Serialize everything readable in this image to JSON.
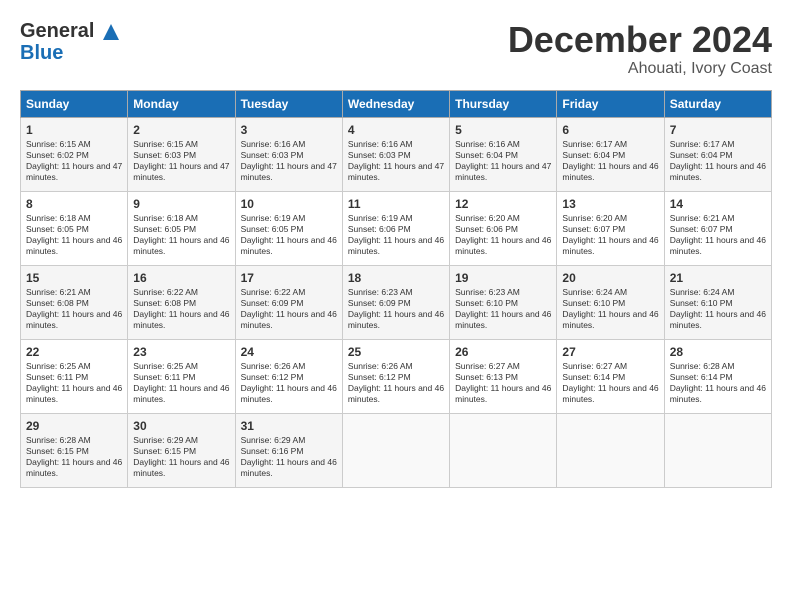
{
  "header": {
    "logo_line1": "General",
    "logo_line2": "Blue",
    "month": "December 2024",
    "location": "Ahouati, Ivory Coast"
  },
  "days_of_week": [
    "Sunday",
    "Monday",
    "Tuesday",
    "Wednesday",
    "Thursday",
    "Friday",
    "Saturday"
  ],
  "weeks": [
    [
      {
        "day": "1",
        "sunrise": "6:15 AM",
        "sunset": "6:02 PM",
        "daylight": "11 hours and 47 minutes."
      },
      {
        "day": "2",
        "sunrise": "6:15 AM",
        "sunset": "6:03 PM",
        "daylight": "11 hours and 47 minutes."
      },
      {
        "day": "3",
        "sunrise": "6:16 AM",
        "sunset": "6:03 PM",
        "daylight": "11 hours and 47 minutes."
      },
      {
        "day": "4",
        "sunrise": "6:16 AM",
        "sunset": "6:03 PM",
        "daylight": "11 hours and 47 minutes."
      },
      {
        "day": "5",
        "sunrise": "6:16 AM",
        "sunset": "6:04 PM",
        "daylight": "11 hours and 47 minutes."
      },
      {
        "day": "6",
        "sunrise": "6:17 AM",
        "sunset": "6:04 PM",
        "daylight": "11 hours and 46 minutes."
      },
      {
        "day": "7",
        "sunrise": "6:17 AM",
        "sunset": "6:04 PM",
        "daylight": "11 hours and 46 minutes."
      }
    ],
    [
      {
        "day": "8",
        "sunrise": "6:18 AM",
        "sunset": "6:05 PM",
        "daylight": "11 hours and 46 minutes."
      },
      {
        "day": "9",
        "sunrise": "6:18 AM",
        "sunset": "6:05 PM",
        "daylight": "11 hours and 46 minutes."
      },
      {
        "day": "10",
        "sunrise": "6:19 AM",
        "sunset": "6:05 PM",
        "daylight": "11 hours and 46 minutes."
      },
      {
        "day": "11",
        "sunrise": "6:19 AM",
        "sunset": "6:06 PM",
        "daylight": "11 hours and 46 minutes."
      },
      {
        "day": "12",
        "sunrise": "6:20 AM",
        "sunset": "6:06 PM",
        "daylight": "11 hours and 46 minutes."
      },
      {
        "day": "13",
        "sunrise": "6:20 AM",
        "sunset": "6:07 PM",
        "daylight": "11 hours and 46 minutes."
      },
      {
        "day": "14",
        "sunrise": "6:21 AM",
        "sunset": "6:07 PM",
        "daylight": "11 hours and 46 minutes."
      }
    ],
    [
      {
        "day": "15",
        "sunrise": "6:21 AM",
        "sunset": "6:08 PM",
        "daylight": "11 hours and 46 minutes."
      },
      {
        "day": "16",
        "sunrise": "6:22 AM",
        "sunset": "6:08 PM",
        "daylight": "11 hours and 46 minutes."
      },
      {
        "day": "17",
        "sunrise": "6:22 AM",
        "sunset": "6:09 PM",
        "daylight": "11 hours and 46 minutes."
      },
      {
        "day": "18",
        "sunrise": "6:23 AM",
        "sunset": "6:09 PM",
        "daylight": "11 hours and 46 minutes."
      },
      {
        "day": "19",
        "sunrise": "6:23 AM",
        "sunset": "6:10 PM",
        "daylight": "11 hours and 46 minutes."
      },
      {
        "day": "20",
        "sunrise": "6:24 AM",
        "sunset": "6:10 PM",
        "daylight": "11 hours and 46 minutes."
      },
      {
        "day": "21",
        "sunrise": "6:24 AM",
        "sunset": "6:10 PM",
        "daylight": "11 hours and 46 minutes."
      }
    ],
    [
      {
        "day": "22",
        "sunrise": "6:25 AM",
        "sunset": "6:11 PM",
        "daylight": "11 hours and 46 minutes."
      },
      {
        "day": "23",
        "sunrise": "6:25 AM",
        "sunset": "6:11 PM",
        "daylight": "11 hours and 46 minutes."
      },
      {
        "day": "24",
        "sunrise": "6:26 AM",
        "sunset": "6:12 PM",
        "daylight": "11 hours and 46 minutes."
      },
      {
        "day": "25",
        "sunrise": "6:26 AM",
        "sunset": "6:12 PM",
        "daylight": "11 hours and 46 minutes."
      },
      {
        "day": "26",
        "sunrise": "6:27 AM",
        "sunset": "6:13 PM",
        "daylight": "11 hours and 46 minutes."
      },
      {
        "day": "27",
        "sunrise": "6:27 AM",
        "sunset": "6:14 PM",
        "daylight": "11 hours and 46 minutes."
      },
      {
        "day": "28",
        "sunrise": "6:28 AM",
        "sunset": "6:14 PM",
        "daylight": "11 hours and 46 minutes."
      }
    ],
    [
      {
        "day": "29",
        "sunrise": "6:28 AM",
        "sunset": "6:15 PM",
        "daylight": "11 hours and 46 minutes."
      },
      {
        "day": "30",
        "sunrise": "6:29 AM",
        "sunset": "6:15 PM",
        "daylight": "11 hours and 46 minutes."
      },
      {
        "day": "31",
        "sunrise": "6:29 AM",
        "sunset": "6:16 PM",
        "daylight": "11 hours and 46 minutes."
      },
      null,
      null,
      null,
      null
    ]
  ]
}
